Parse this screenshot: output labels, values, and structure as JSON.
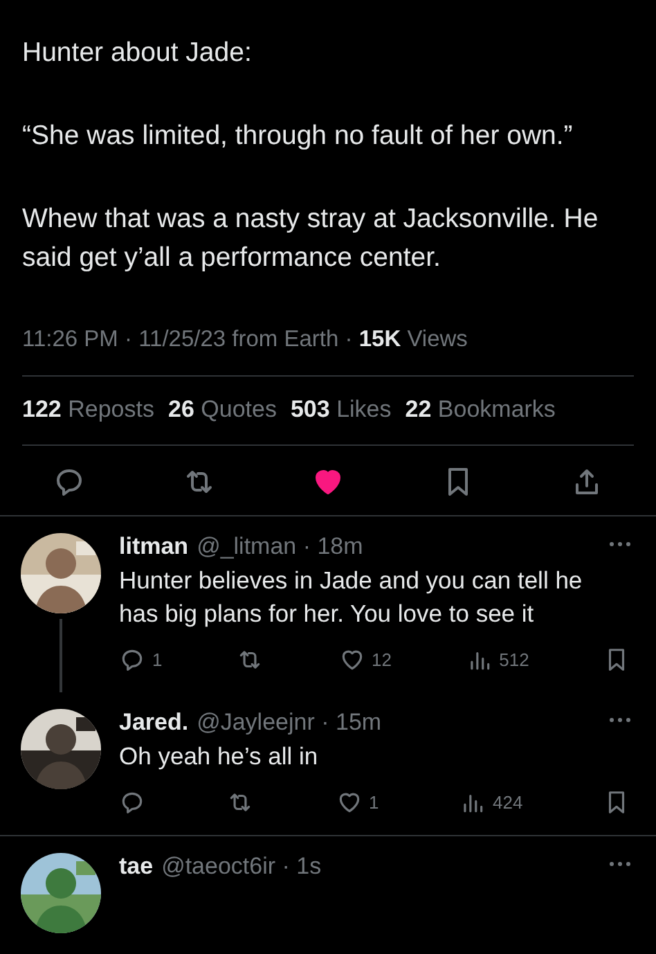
{
  "post": {
    "paragraphs": [
      "Hunter about Jade:",
      "“She was limited, through no fault of her own.”",
      "Whew that was a nasty stray at Jacksonville. He said get y’all a performance center."
    ],
    "meta": "11:26 PM · 11/25/23 from Earth · **15K** Views",
    "stats": [
      {
        "count": "122",
        "label": "Reposts"
      },
      {
        "count": "26",
        "label": "Quotes"
      },
      {
        "count": "503",
        "label": "Likes"
      },
      {
        "count": "22",
        "label": "Bookmarks"
      }
    ],
    "actions": [
      {
        "kind": "reply"
      },
      {
        "kind": "repost"
      },
      {
        "kind": "like",
        "liked": true
      },
      {
        "kind": "bookmark"
      },
      {
        "kind": "share"
      }
    ]
  },
  "replies": [
    {
      "name": "litman",
      "handle": "@_litman · 18m",
      "text": "Hunter believes in Jade and you can tell he has big plans for her. You love to see it",
      "threaded": true,
      "actions": [
        {
          "kind": "reply",
          "count": "1"
        },
        {
          "kind": "repost"
        },
        {
          "kind": "like",
          "count": "12",
          "liked": false
        },
        {
          "kind": "views",
          "count": "512"
        },
        {
          "kind": "bookmark"
        }
      ]
    },
    {
      "name": "Jared.",
      "handle": "@Jayleejnr · 15m",
      "text": "Oh yeah he’s all in",
      "threaded": false,
      "actions": [
        {
          "kind": "reply"
        },
        {
          "kind": "repost"
        },
        {
          "kind": "like",
          "count": "1",
          "liked": false
        },
        {
          "kind": "views",
          "count": "424"
        },
        {
          "kind": "bookmark"
        }
      ]
    },
    {
      "name": "tae",
      "handle": "@taeoct6ir · 1s",
      "threaded": false
    }
  ]
}
